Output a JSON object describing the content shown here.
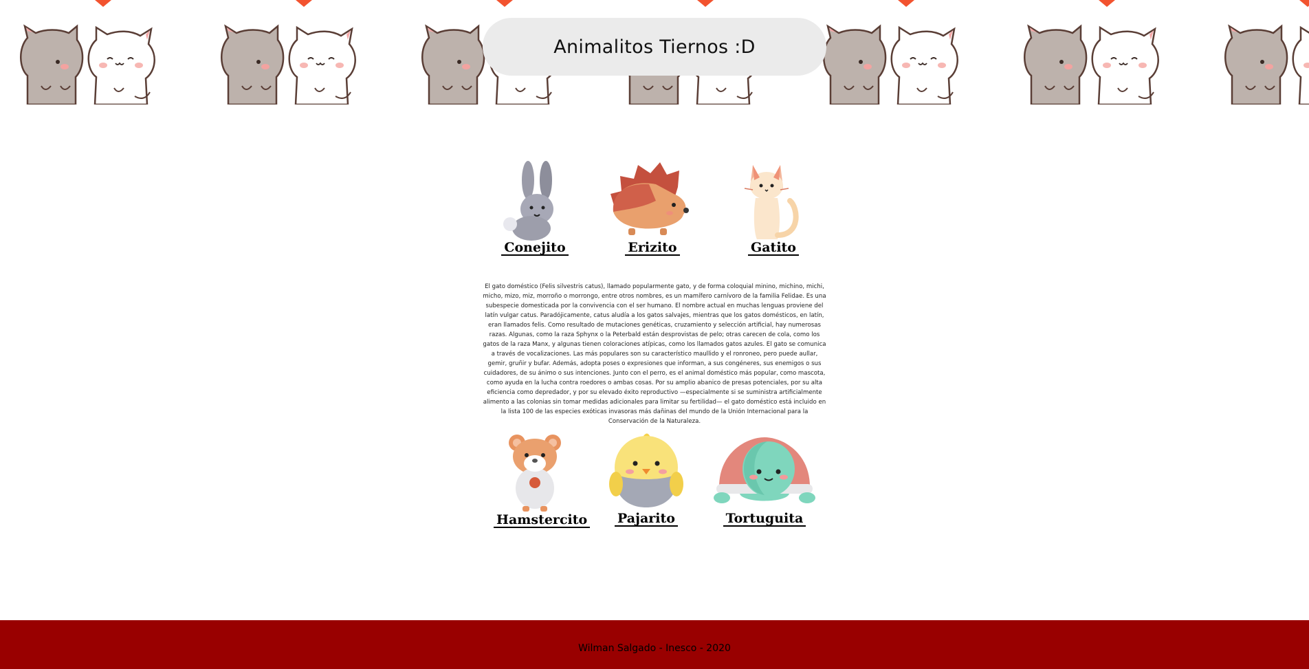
{
  "header": {
    "title": "Animalitos Tiernos :D",
    "banner_image": "kissing-cats-pattern"
  },
  "animals_top": [
    {
      "name": "Conejito",
      "icon": "rabbit-icon"
    },
    {
      "name": "Erizito",
      "icon": "hedgehog-icon"
    },
    {
      "name": "Gatito",
      "icon": "cat-icon"
    }
  ],
  "description": "El gato doméstico (Felis silvestris catus), llamado popularmente gato, y de forma coloquial minino, michino, michi, micho, mizo, miz, morroño o morrongo, entre otros nombres, es un mamífero carnívoro de la familia Felidae. Es una subespecie domesticada por la convivencia con el ser humano. El nombre actual en muchas lenguas proviene del latín vulgar catus. Paradójicamente, catus aludía a los gatos salvajes, mientras que los gatos domésticos, en latín, eran llamados felis. Como resultado de mutaciones genéticas, cruzamiento y selección artificial, hay numerosas razas. Algunas, como la raza Sphynx o la Peterbald están desprovistas de pelo; otras carecen de cola, como los gatos de la raza Manx, y algunas tienen coloraciones atípicas, como los llamados gatos azules. El gato se comunica a través de vocalizaciones. Las más populares son su característico maullido y el ronroneo, pero puede aullar, gemir, gruñir y bufar. Además, adopta poses o expresiones que informan, a sus congéneres, sus enemigos o sus cuidadores, de su ánimo o sus intenciones. Junto con el perro, es el animal doméstico más popular, como mascota, como ayuda en la lucha contra roedores o ambas cosas. Por su amplio abanico de presas potenciales, por su alta eficiencia como depredador, y por su elevado éxito reproductivo —especialmente si se suministra artificialmente alimento a las colonias sin tomar medidas adicionales para limitar su fertilidad— el gato doméstico está incluido en la lista 100 de las especies exóticas invasoras más dañinas del mundo de la Unión Internacional para la Conservación de la Naturaleza.",
  "animals_bottom": [
    {
      "name": "Hamstercito",
      "icon": "hamster-icon"
    },
    {
      "name": "Pajarito",
      "icon": "chick-icon"
    },
    {
      "name": "Tortuguita",
      "icon": "turtle-icon"
    }
  ],
  "footer": {
    "text": "Wilman Salgado - Inesco - 2020"
  },
  "colors": {
    "title_pill": "#ebebeb",
    "footer_bg": "#990000",
    "heart": "#f2532f"
  }
}
